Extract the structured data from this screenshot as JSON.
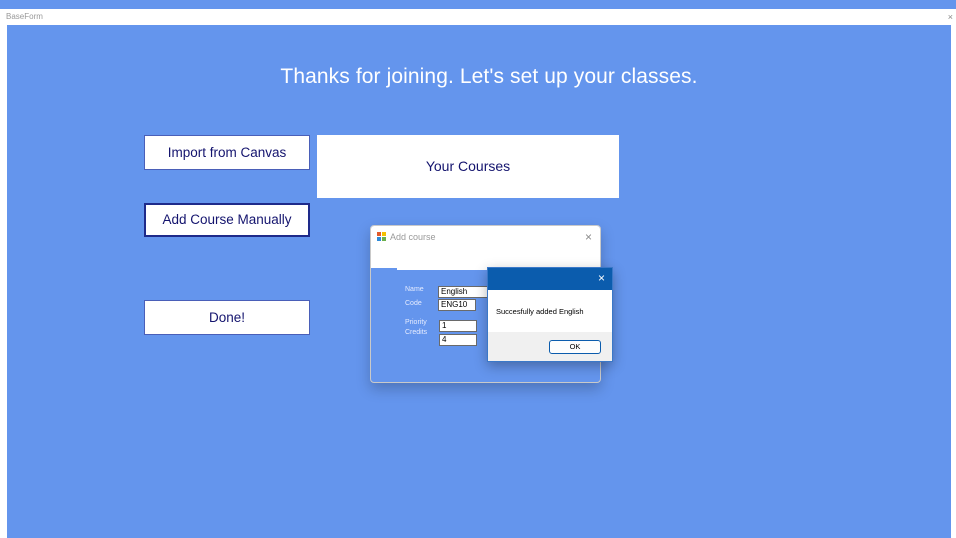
{
  "window": {
    "title": "BaseForm",
    "close_glyph": "×"
  },
  "main": {
    "heading": "Thanks for joining.  Let's set up your classes.",
    "buttons": {
      "import": "Import from Canvas",
      "manual": "Add Course Manually",
      "done": "Done!"
    },
    "courses_panel_label": "Your Courses"
  },
  "add_course_dialog": {
    "title": "Add course",
    "close_glyph": "×",
    "icon": "app-form-icon",
    "fields": {
      "name": {
        "label": "Name",
        "value": "English"
      },
      "code": {
        "label": "Code",
        "value": "ENG10"
      },
      "priority": {
        "label": "Priority",
        "value": "1"
      },
      "credits": {
        "label": "Credits",
        "value": "4"
      }
    }
  },
  "message_box": {
    "text": "Succesfully added English",
    "ok_label": "OK",
    "close_glyph": "×"
  },
  "colors": {
    "background": "#6495ed",
    "button_text": "#14146e",
    "message_titlebar": "#0b5cad"
  }
}
